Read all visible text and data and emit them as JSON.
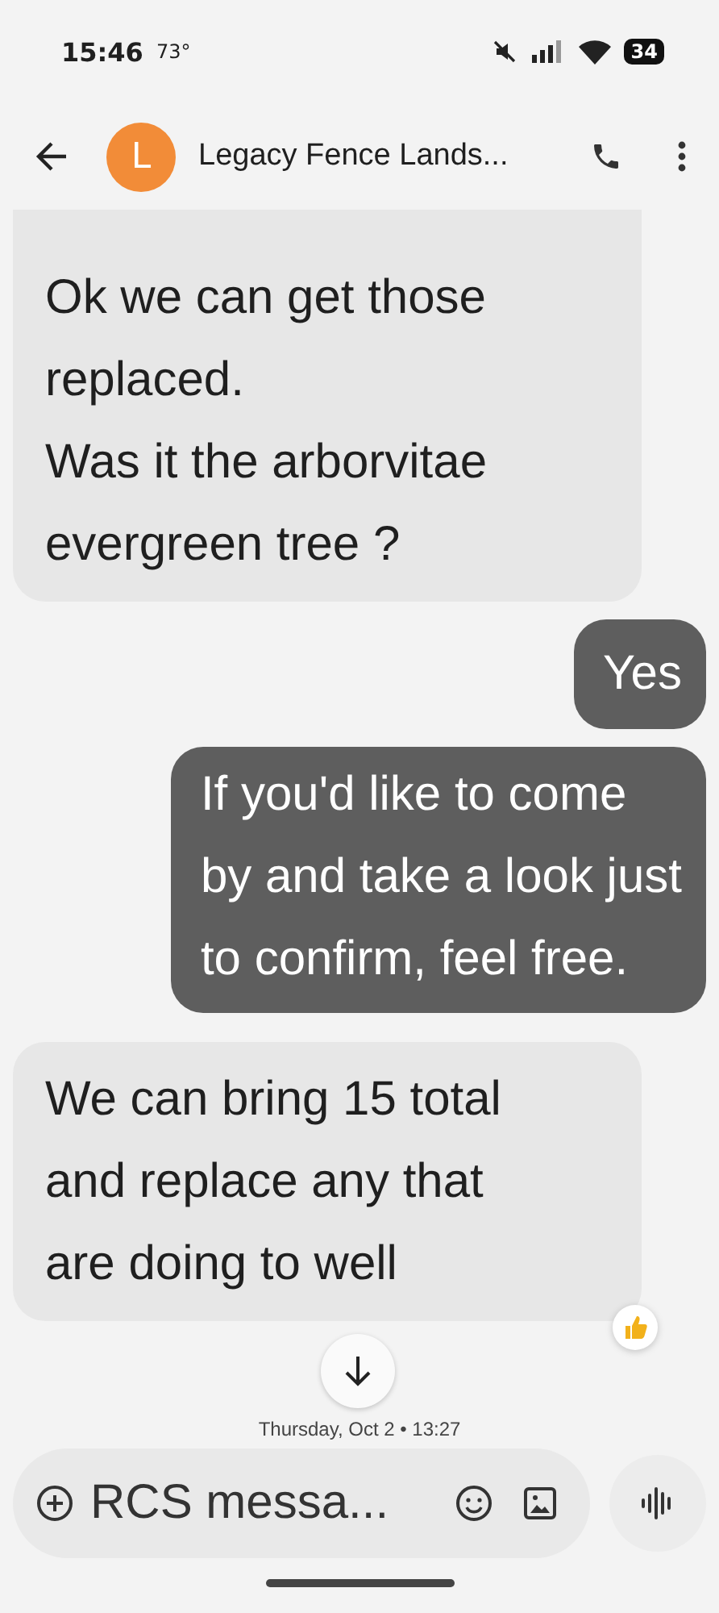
{
  "status_bar": {
    "time": "15:46",
    "temperature": "73°",
    "battery": "34"
  },
  "header": {
    "avatar_letter": "L",
    "title": "Legacy Fence Lands..."
  },
  "messages": [
    {
      "outgoing": false,
      "lines": [
        "Ok we can get those",
        "replaced.",
        "Was it the arborvitae",
        "evergreen tree ?"
      ],
      "reacted": false
    },
    {
      "outgoing": true,
      "lines": [
        "Yes"
      ],
      "reacted": false
    },
    {
      "outgoing": true,
      "lines": [
        "If you'd like to come",
        "by and take a look just",
        "to confirm, feel free."
      ],
      "reacted": false
    },
    {
      "outgoing": false,
      "lines": [
        "We can bring 15 total",
        "and replace any that",
        "are doing to well"
      ],
      "reacted": true
    }
  ],
  "timestamp": "Thursday, Oct 2 • 13:27",
  "composer": {
    "placeholder": "RCS messa..."
  }
}
